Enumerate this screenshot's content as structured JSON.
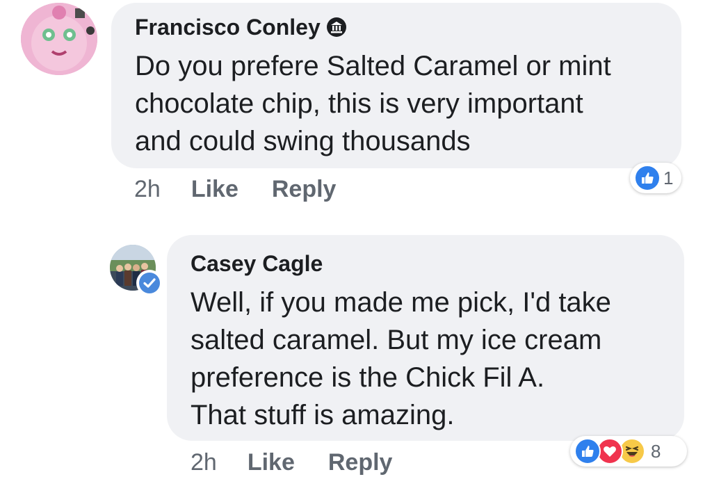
{
  "comments": [
    {
      "author": "Francisco Conley",
      "badge": "top-fan-icon",
      "text": "Do you prefere Salted Caramel or mint\nchocolate chip, this is very important\nand could swing thousands",
      "time": "2h",
      "like_label": "Like",
      "reply_label": "Reply",
      "reactions": [
        "like"
      ],
      "reaction_count": "1"
    },
    {
      "author": "Casey Cagle",
      "badge": "verified-icon",
      "text": "Well, if you made me pick, I'd take\nsalted caramel.   But my ice cream\npreference is the Chick Fil A.\nThat stuff is amazing.",
      "time": "2h",
      "like_label": "Like",
      "reply_label": "Reply",
      "reactions": [
        "like",
        "love",
        "haha"
      ],
      "reaction_count": "8"
    }
  ],
  "colors": {
    "bubble": "#f0f1f4",
    "meta_text": "#606770",
    "like_blue": "#2f80ed",
    "love_red": "#f0334e",
    "haha_yellow": "#f7c948",
    "verified_blue": "#4a89dc"
  }
}
